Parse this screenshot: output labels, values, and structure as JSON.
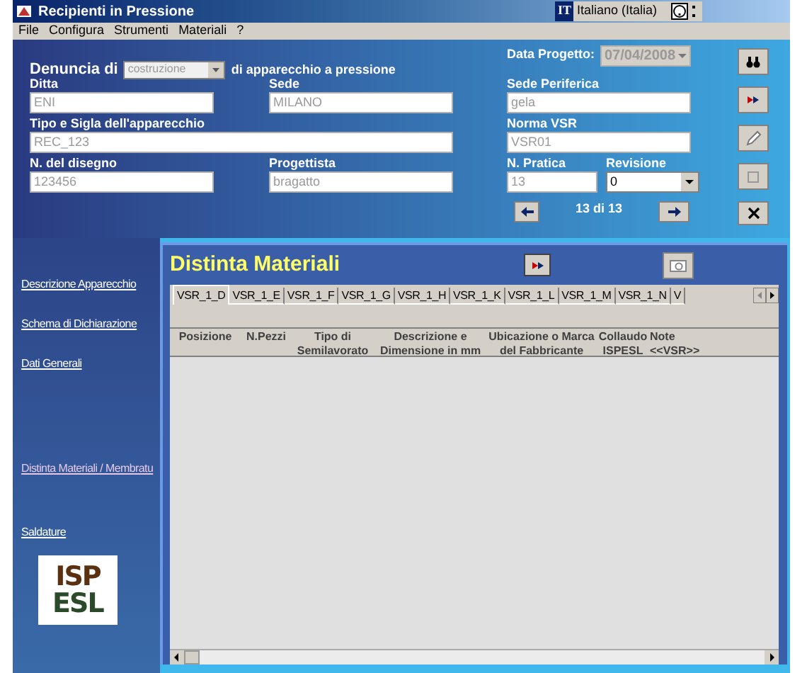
{
  "window": {
    "title": "Recipienti in Pressione",
    "language": "Italiano (Italia)",
    "lang_code": "IT"
  },
  "menu": [
    "File",
    "Configura",
    "Strumenti",
    "Materiali",
    "?"
  ],
  "form": {
    "denuncia_label": "Denuncia di",
    "denuncia_value": "costruzione",
    "denuncia_suffix": "di apparecchio a pressione",
    "data_label": "Data Progetto:",
    "data_value": "07/04/2008",
    "fields": [
      {
        "label": "Ditta",
        "value": "ENI",
        "kind": "text"
      },
      {
        "label": "Sede",
        "value": "MILANO",
        "kind": "text"
      },
      {
        "label": "Sede Periferica",
        "value": "gela",
        "kind": "text"
      },
      {
        "label": "Tipo e Sigla dell'apparecchio",
        "value": "REC_123",
        "kind": "wide"
      },
      {
        "label": "Norma VSR",
        "value": "VSR01",
        "kind": "text"
      },
      {
        "label": "N. del disegno",
        "value": "123456",
        "kind": "text"
      },
      {
        "label": "Progettista",
        "value": "bragatto",
        "kind": "text"
      }
    ],
    "pratica_label": "N. Pratica",
    "pratica_value": "13",
    "revisione_label": "Revisione",
    "revisione_value": "0",
    "record_counter": "13 di 13"
  },
  "sidebar": {
    "items": [
      {
        "label": "Descrizione Apparecchio",
        "selected": false
      },
      {
        "label": "Schema di Dichiarazione",
        "selected": false
      },
      {
        "label": "Dati Generali",
        "selected": false
      },
      {
        "label": "Distinta Materiali / Membratu",
        "selected": true
      },
      {
        "label": "Saldature",
        "selected": false
      }
    ],
    "logo": [
      "ISP",
      "ESL"
    ]
  },
  "panel": {
    "title": "Distinta Materiali",
    "tabs": [
      {
        "label": "VSR_1_D",
        "selected": true
      },
      {
        "label": "VSR_1_E",
        "selected": false
      },
      {
        "label": "VSR_1_F",
        "selected": false
      },
      {
        "label": "VSR_1_G",
        "selected": false
      },
      {
        "label": "VSR_1_H",
        "selected": false
      },
      {
        "label": "VSR_1_K",
        "selected": false
      },
      {
        "label": "VSR_1_L",
        "selected": false
      },
      {
        "label": "VSR_1_M",
        "selected": false
      },
      {
        "label": "VSR_1_N",
        "selected": false
      },
      {
        "label": "V",
        "selected": false
      }
    ],
    "columns": [
      "Posizione",
      "N.Pezzi",
      "Tipo di\nSemilavorato",
      "Descrizione e\nDimensione in mm",
      "Ubicazione o Marca\ndel Fabbricante",
      "Collaudo\nISPESL",
      "Note\n<<VSR>>"
    ]
  }
}
